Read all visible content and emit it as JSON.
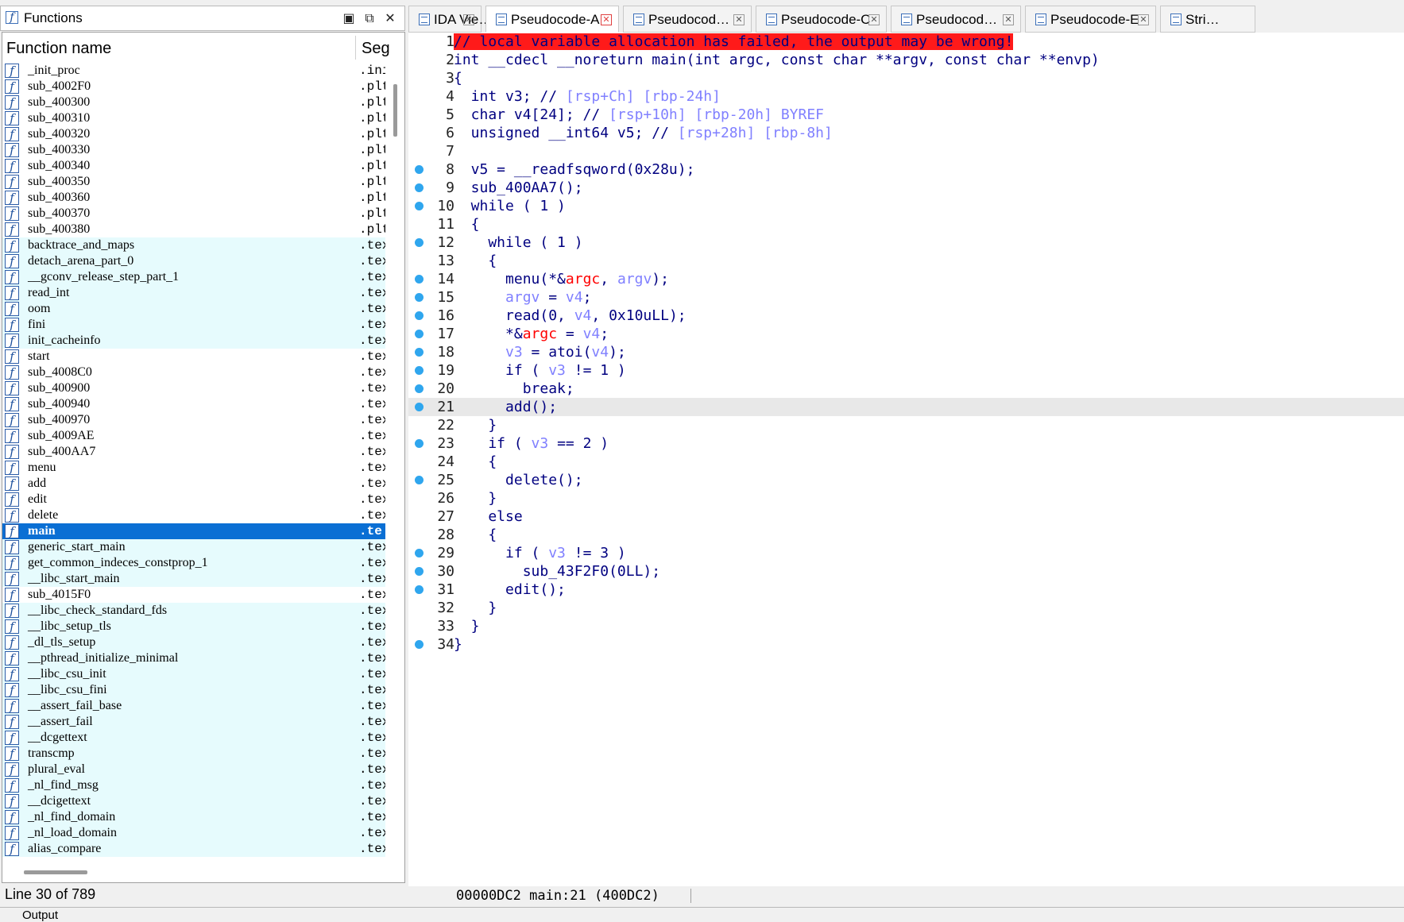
{
  "functions_panel": {
    "title": "Functions",
    "column_name": "Function name",
    "column_segment": "Seg",
    "status": "Line 30 of 789",
    "rows": [
      {
        "name": "_init_proc",
        "seg": ".ini",
        "kind": "plain"
      },
      {
        "name": "sub_4002F0",
        "seg": ".plt",
        "kind": "plain"
      },
      {
        "name": "sub_400300",
        "seg": ".plt",
        "kind": "plain"
      },
      {
        "name": "sub_400310",
        "seg": ".plt",
        "kind": "plain"
      },
      {
        "name": "sub_400320",
        "seg": ".plt",
        "kind": "plain"
      },
      {
        "name": "sub_400330",
        "seg": ".plt",
        "kind": "plain"
      },
      {
        "name": "sub_400340",
        "seg": ".plt",
        "kind": "plain"
      },
      {
        "name": "sub_400350",
        "seg": ".plt",
        "kind": "plain"
      },
      {
        "name": "sub_400360",
        "seg": ".plt",
        "kind": "plain"
      },
      {
        "name": "sub_400370",
        "seg": ".plt",
        "kind": "plain"
      },
      {
        "name": "sub_400380",
        "seg": ".plt",
        "kind": "plain"
      },
      {
        "name": "backtrace_and_maps",
        "seg": ".tex",
        "kind": "text"
      },
      {
        "name": "detach_arena_part_0",
        "seg": ".tex",
        "kind": "text"
      },
      {
        "name": "__gconv_release_step_part_1",
        "seg": ".tex",
        "kind": "text"
      },
      {
        "name": "read_int",
        "seg": ".tex",
        "kind": "text"
      },
      {
        "name": "oom",
        "seg": ".tex",
        "kind": "text"
      },
      {
        "name": "fini",
        "seg": ".tex",
        "kind": "text"
      },
      {
        "name": "init_cacheinfo",
        "seg": ".tex",
        "kind": "text"
      },
      {
        "name": "start",
        "seg": ".tex",
        "kind": "plain"
      },
      {
        "name": "sub_4008C0",
        "seg": ".tex",
        "kind": "plain"
      },
      {
        "name": "sub_400900",
        "seg": ".tex",
        "kind": "plain"
      },
      {
        "name": "sub_400940",
        "seg": ".tex",
        "kind": "plain"
      },
      {
        "name": "sub_400970",
        "seg": ".tex",
        "kind": "plain"
      },
      {
        "name": "sub_4009AE",
        "seg": ".tex",
        "kind": "plain"
      },
      {
        "name": "sub_400AA7",
        "seg": ".tex",
        "kind": "plain"
      },
      {
        "name": "menu",
        "seg": ".tex",
        "kind": "plain"
      },
      {
        "name": "add",
        "seg": ".tex",
        "kind": "plain"
      },
      {
        "name": "edit",
        "seg": ".tex",
        "kind": "plain"
      },
      {
        "name": "delete",
        "seg": ".tex",
        "kind": "plain"
      },
      {
        "name": "main",
        "seg": ".te",
        "kind": "selected"
      },
      {
        "name": "generic_start_main",
        "seg": ".tex",
        "kind": "text"
      },
      {
        "name": "get_common_indeces_constprop_1",
        "seg": ".tex",
        "kind": "text"
      },
      {
        "name": "__libc_start_main",
        "seg": ".tex",
        "kind": "text"
      },
      {
        "name": "sub_4015F0",
        "seg": ".tex",
        "kind": "plain"
      },
      {
        "name": "__libc_check_standard_fds",
        "seg": ".tex",
        "kind": "text"
      },
      {
        "name": "__libc_setup_tls",
        "seg": ".tex",
        "kind": "text"
      },
      {
        "name": "_dl_tls_setup",
        "seg": ".tex",
        "kind": "text"
      },
      {
        "name": "__pthread_initialize_minimal",
        "seg": ".tex",
        "kind": "text"
      },
      {
        "name": "__libc_csu_init",
        "seg": ".tex",
        "kind": "text"
      },
      {
        "name": "__libc_csu_fini",
        "seg": ".tex",
        "kind": "text"
      },
      {
        "name": "__assert_fail_base",
        "seg": ".tex",
        "kind": "text"
      },
      {
        "name": "__assert_fail",
        "seg": ".tex",
        "kind": "text"
      },
      {
        "name": "__dcgettext",
        "seg": ".tex",
        "kind": "text"
      },
      {
        "name": "transcmp",
        "seg": ".tex",
        "kind": "text"
      },
      {
        "name": "plural_eval",
        "seg": ".tex",
        "kind": "text"
      },
      {
        "name": "_nl_find_msg",
        "seg": ".tex",
        "kind": "text"
      },
      {
        "name": "__dcigettext",
        "seg": ".tex",
        "kind": "text"
      },
      {
        "name": "_nl_find_domain",
        "seg": ".tex",
        "kind": "text"
      },
      {
        "name": "_nl_load_domain",
        "seg": ".tex",
        "kind": "text"
      },
      {
        "name": "alias_compare",
        "seg": ".tex",
        "kind": "text"
      }
    ]
  },
  "tabs": [
    {
      "label": "IDA Vie…",
      "active": false
    },
    {
      "label": "Pseudocode-A",
      "active": true
    },
    {
      "label": "Pseudocod…",
      "active": false
    },
    {
      "label": "Pseudocode-C",
      "active": false
    },
    {
      "label": "Pseudocod…",
      "active": false
    },
    {
      "label": "Pseudocode-E",
      "active": false
    },
    {
      "label": "Stri…",
      "active": false
    }
  ],
  "code": {
    "current_line": 21,
    "lines": [
      {
        "n": "1",
        "bp": false,
        "html": "<span class=\"warn\">// local variable allocation has failed, the output may be wrong!</span>"
      },
      {
        "n": "2",
        "bp": false,
        "html": "int __cdecl __noreturn main(int argc, const char **argv, const char **envp)"
      },
      {
        "n": "3",
        "bp": false,
        "html": "{"
      },
      {
        "n": "4",
        "bp": false,
        "html": "  int v3; // <span class=\"cmt\">[rsp+Ch] [rbp-24h]</span>"
      },
      {
        "n": "5",
        "bp": false,
        "html": "  char v4[24]; // <span class=\"cmt\">[rsp+10h] [rbp-20h] BYREF</span>"
      },
      {
        "n": "6",
        "bp": false,
        "html": "  unsigned __int64 v5; // <span class=\"cmt\">[rsp+28h] [rbp-8h]</span>"
      },
      {
        "n": "7",
        "bp": false,
        "html": ""
      },
      {
        "n": "8",
        "bp": true,
        "html": "  v5 = __readfsqword(0x28u);"
      },
      {
        "n": "9",
        "bp": true,
        "html": "  sub_400AA7();"
      },
      {
        "n": "10",
        "bp": true,
        "html": "  while ( 1 )"
      },
      {
        "n": "11",
        "bp": false,
        "html": "  {"
      },
      {
        "n": "12",
        "bp": true,
        "html": "    while ( 1 )"
      },
      {
        "n": "13",
        "bp": false,
        "html": "    {"
      },
      {
        "n": "14",
        "bp": true,
        "html": "      menu(*&amp;<span class=\"arg\">argc</span>, <span class=\"var\">argv</span>);"
      },
      {
        "n": "15",
        "bp": true,
        "html": "      <span class=\"var\">argv</span> = <span class=\"var\">v4</span>;"
      },
      {
        "n": "16",
        "bp": true,
        "html": "      read(0, <span class=\"var\">v4</span>, 0x10uLL);"
      },
      {
        "n": "17",
        "bp": true,
        "html": "      *&amp;<span class=\"arg\">argc</span> = <span class=\"var\">v4</span>;"
      },
      {
        "n": "18",
        "bp": true,
        "html": "      <span class=\"var\">v3</span> = atoi(<span class=\"var\">v4</span>);"
      },
      {
        "n": "19",
        "bp": true,
        "html": "      if ( <span class=\"var\">v3</span> != 1 )"
      },
      {
        "n": "20",
        "bp": true,
        "html": "        break;"
      },
      {
        "n": "21",
        "bp": true,
        "html": "      add();"
      },
      {
        "n": "22",
        "bp": false,
        "html": "    }"
      },
      {
        "n": "23",
        "bp": true,
        "html": "    if ( <span class=\"var\">v3</span> == 2 )"
      },
      {
        "n": "24",
        "bp": false,
        "html": "    {"
      },
      {
        "n": "25",
        "bp": true,
        "html": "      delete();"
      },
      {
        "n": "26",
        "bp": false,
        "html": "    }"
      },
      {
        "n": "27",
        "bp": false,
        "html": "    else"
      },
      {
        "n": "28",
        "bp": false,
        "html": "    {"
      },
      {
        "n": "29",
        "bp": true,
        "html": "      if ( <span class=\"var\">v3</span> != 3 )"
      },
      {
        "n": "30",
        "bp": true,
        "html": "        sub_43F2F0(0LL);"
      },
      {
        "n": "31",
        "bp": true,
        "html": "      edit();"
      },
      {
        "n": "32",
        "bp": false,
        "html": "    }"
      },
      {
        "n": "33",
        "bp": false,
        "html": "  }"
      },
      {
        "n": "34",
        "bp": true,
        "html": "}"
      }
    ]
  },
  "code_status": {
    "address": "00000DC2 main:21 (400DC2)"
  },
  "output": {
    "label": "Output"
  },
  "colors": {
    "selection": "#0a6fd4",
    "text_segment_row": "#e6fbfd",
    "warning_bg": "#ff1a1a",
    "keyword": "#000080",
    "variable": "#8080ff",
    "argument": "#ff0000",
    "breakpoint_dot": "#2fa6ee"
  },
  "icons": {
    "function": "function-f-icon",
    "pseudocode_tab": "pseudocode-icon",
    "maximize": "maximize-icon",
    "restore": "restore-icon",
    "close": "close-icon"
  }
}
